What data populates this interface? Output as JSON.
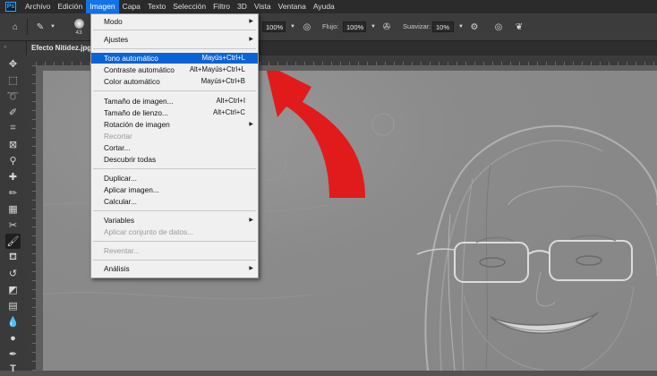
{
  "menubar": {
    "logo": "Ps",
    "items": [
      "Archivo",
      "Edición",
      "Imagen",
      "Capa",
      "Texto",
      "Selección",
      "Filtro",
      "3D",
      "Vista",
      "Ventana",
      "Ayuda"
    ],
    "active_index": 2
  },
  "options": {
    "brush_size": "43",
    "opacity": "100%",
    "flow_label": "Flujo:",
    "flow": "100%",
    "smoothing_label": "Suavizar:",
    "smoothing": "10%"
  },
  "document": {
    "tab_title": "Efecto Nitidez.jpg"
  },
  "dropdown": {
    "items": [
      {
        "label": "Modo",
        "submenu": true
      },
      {
        "label": "Ajustes",
        "submenu": true
      },
      {
        "label": "Tono automático",
        "shortcut": "Mayús+Ctrl+L",
        "highlight": true
      },
      {
        "label": "Contraste automático",
        "shortcut": "Alt+Mayús+Ctrl+L"
      },
      {
        "label": "Color automático",
        "shortcut": "Mayús+Ctrl+B"
      },
      {
        "label": "Tamaño de imagen...",
        "shortcut": "Alt+Ctrl+I"
      },
      {
        "label": "Tamaño de lienzo...",
        "shortcut": "Alt+Ctrl+C"
      },
      {
        "label": "Rotación de imagen",
        "submenu": true
      },
      {
        "label": "Recortar",
        "disabled": true
      },
      {
        "label": "Cortar..."
      },
      {
        "label": "Descubrir todas"
      },
      {
        "label": "Duplicar..."
      },
      {
        "label": "Aplicar imagen..."
      },
      {
        "label": "Calcular..."
      },
      {
        "label": "Variables",
        "submenu": true
      },
      {
        "label": "Aplicar conjunto de datos...",
        "disabled": true
      },
      {
        "label": "Reventar...",
        "disabled": true
      },
      {
        "label": "Análisis",
        "submenu": true
      }
    ]
  },
  "colors": {
    "accent": "#1473e6",
    "arrow": "#e11b1b",
    "menu_bg": "#f0f0f0"
  }
}
